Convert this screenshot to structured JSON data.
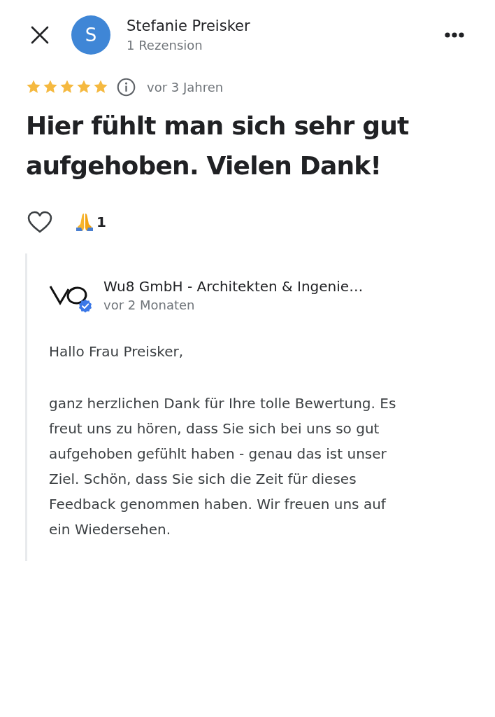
{
  "header": {
    "avatar_letter": "S",
    "reviewer_name": "Stefanie Preisker",
    "review_count": "1 Rezension"
  },
  "review": {
    "stars": 5,
    "time": "vor 3 Jahren",
    "text": "Hier fühlt man sich sehr gut aufgehoben. Vielen Dank!",
    "liked": false,
    "reactions": [
      {
        "count": "1"
      }
    ]
  },
  "owner_reply": {
    "name": "Wu8 GmbH - Architekten & Ingenie…",
    "verified": true,
    "time": "vor 2 Monaten",
    "paragraphs": [
      "Hallo Frau Preisker,",
      "ganz herzlichen Dank für Ihre tolle Bewertung. Es freut uns zu hören, dass Sie sich bei uns so gut aufgehoben gefühlt haben - genau das ist unser Ziel. Schön, dass Sie sich die Zeit für dieses Feedback genommen haben. Wir freuen uns auf ein Wiedersehen."
    ]
  }
}
